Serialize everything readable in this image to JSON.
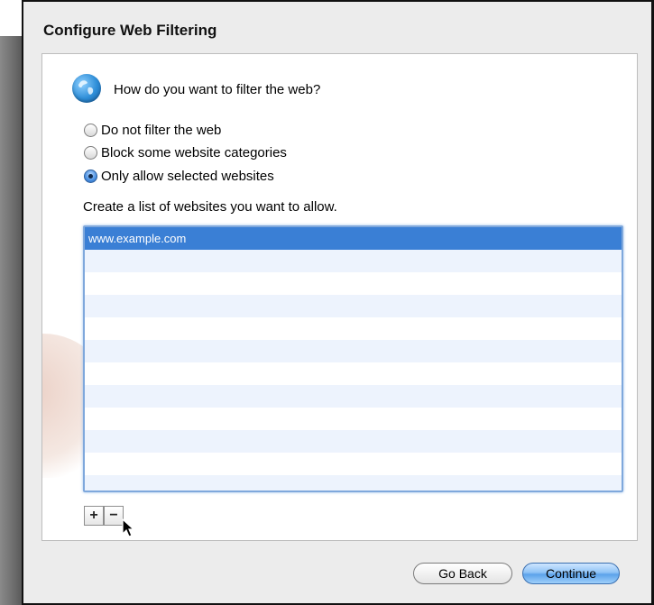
{
  "dialog": {
    "title": "Configure Web Filtering",
    "question": "How do you want to filter the web?",
    "icon": "globe-icon"
  },
  "filter_options": [
    {
      "label": "Do not filter the web",
      "selected": false
    },
    {
      "label": "Block some website categories",
      "selected": false
    },
    {
      "label": "Only allow selected websites",
      "selected": true
    }
  ],
  "allowed_list": {
    "caption": "Create a list of websites you want to allow.",
    "items": [
      "www.example.com"
    ],
    "selected_index": 0
  },
  "list_controls": {
    "add_label": "+",
    "remove_label": "−"
  },
  "buttons": {
    "back_label": "Go Back",
    "continue_label": "Continue"
  },
  "colors": {
    "selection": "#3a7fd5",
    "default_button": "#5ca2ea"
  }
}
